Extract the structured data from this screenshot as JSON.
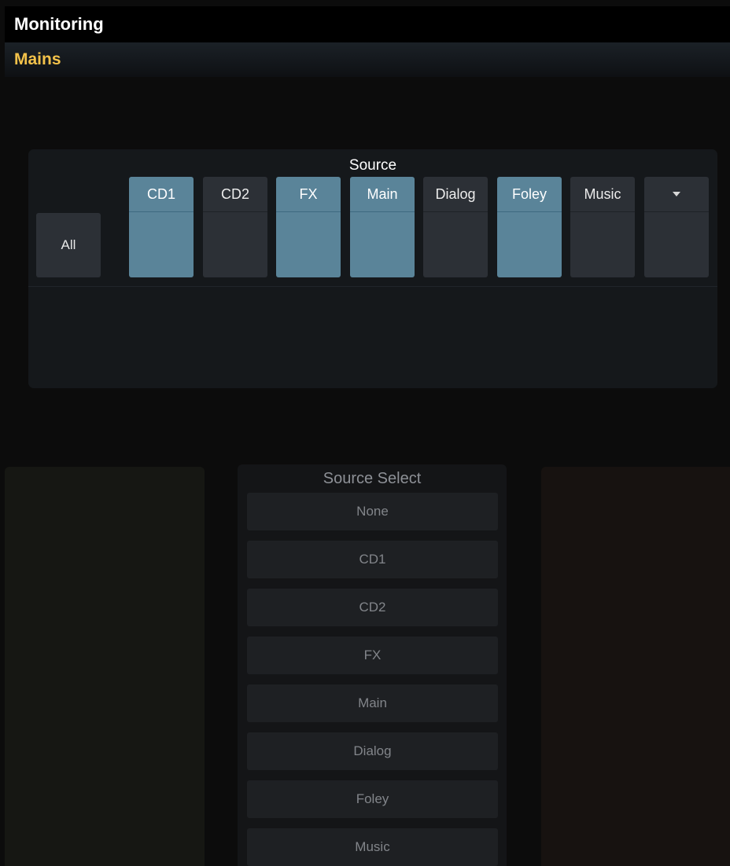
{
  "header": {
    "title": "Monitoring",
    "subtitle": "Mains"
  },
  "colors": {
    "accent": "#f3c24a",
    "active_button": "#5a8499",
    "inactive_button": "#2c3036"
  },
  "source": {
    "title": "Source",
    "all_label": "All",
    "buttons": [
      {
        "label": "CD1",
        "active": true
      },
      {
        "label": "CD2",
        "active": false
      },
      {
        "label": "FX",
        "active": true
      },
      {
        "label": "Main",
        "active": true
      },
      {
        "label": "Dialog",
        "active": false
      },
      {
        "label": "Foley",
        "active": true
      },
      {
        "label": "Music",
        "active": false
      }
    ],
    "more_icon": "triangle-down-icon"
  },
  "source_select": {
    "title": "Source Select",
    "options": [
      "None",
      "CD1",
      "CD2",
      "FX",
      "Main",
      "Dialog",
      "Foley",
      "Music"
    ]
  }
}
